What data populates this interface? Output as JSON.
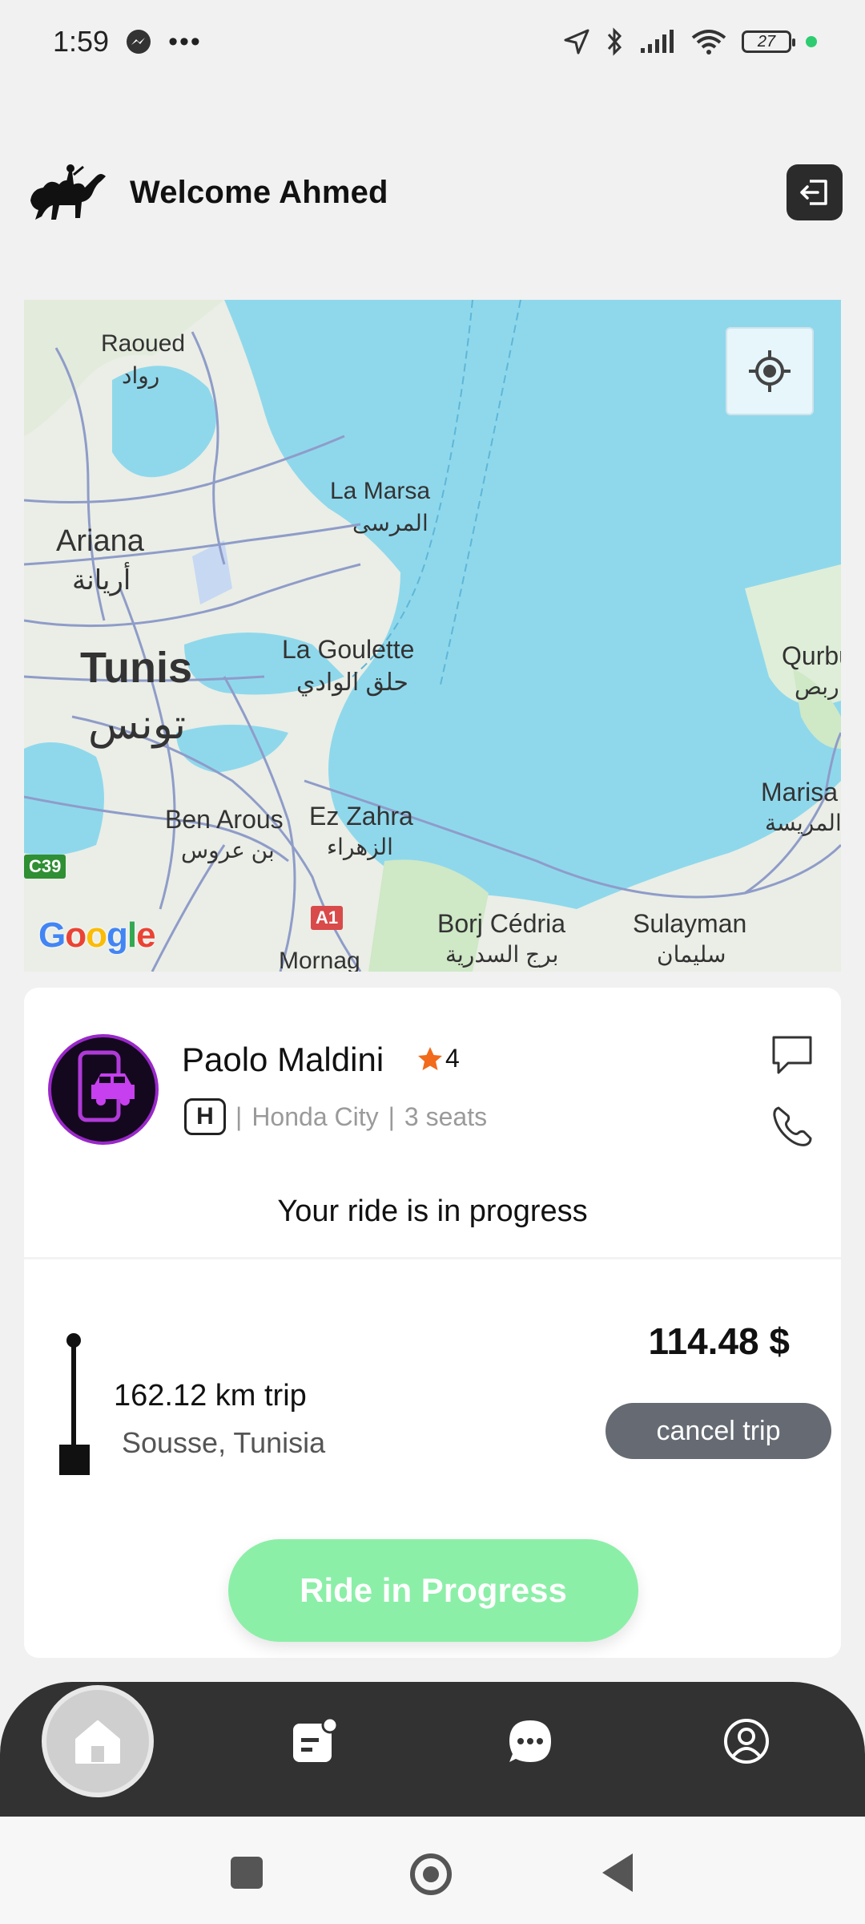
{
  "status_bar": {
    "time": "1:59",
    "battery": "27"
  },
  "header": {
    "welcome": "Welcome Ahmed"
  },
  "map": {
    "labels": {
      "raoued": "Raoued",
      "raoued_ar": "رواد",
      "la_marsa": "La Marsa",
      "la_marsa_ar": "المرسى",
      "ariana": "Ariana",
      "ariana_ar": "أريانة",
      "tunis": "Tunis",
      "tunis_ar": "تونس",
      "la_goulette": "La Goulette",
      "la_goulette_ar": "حلق الوادي",
      "qurbus": "Qurbu",
      "qurbus_ar": "ربص",
      "marisa": "Marisa",
      "marisa_ar": "المريسة",
      "ben_arous": "Ben Arous",
      "ben_arous_ar": "بن عروس",
      "ez_zahra": "Ez Zahra",
      "ez_zahra_ar": "الزهراء",
      "borj_cedria": "Borj Cédria",
      "borj_cedria_ar": "برج السدرية",
      "sulayman": "Sulayman",
      "sulayman_ar": "سليمان",
      "mornag": "Mornag",
      "c39": "C39",
      "a1": "A1"
    },
    "attribution": "Google"
  },
  "driver": {
    "name": "Paolo Maldini",
    "rating": "4",
    "car_model": "Honda City",
    "seats": "3 seats",
    "separator": "|"
  },
  "ride": {
    "status": "Your ride is in progress",
    "distance": "162.12 km trip",
    "destination": "Sousse, Tunisia",
    "price": "114.48 $",
    "cancel_label": "cancel trip",
    "progress_label": "Ride in Progress"
  },
  "colors": {
    "accent_green": "#8cefa8",
    "nav_dark": "#323232",
    "water": "#8fd8ec",
    "star": "#f26a1b"
  }
}
